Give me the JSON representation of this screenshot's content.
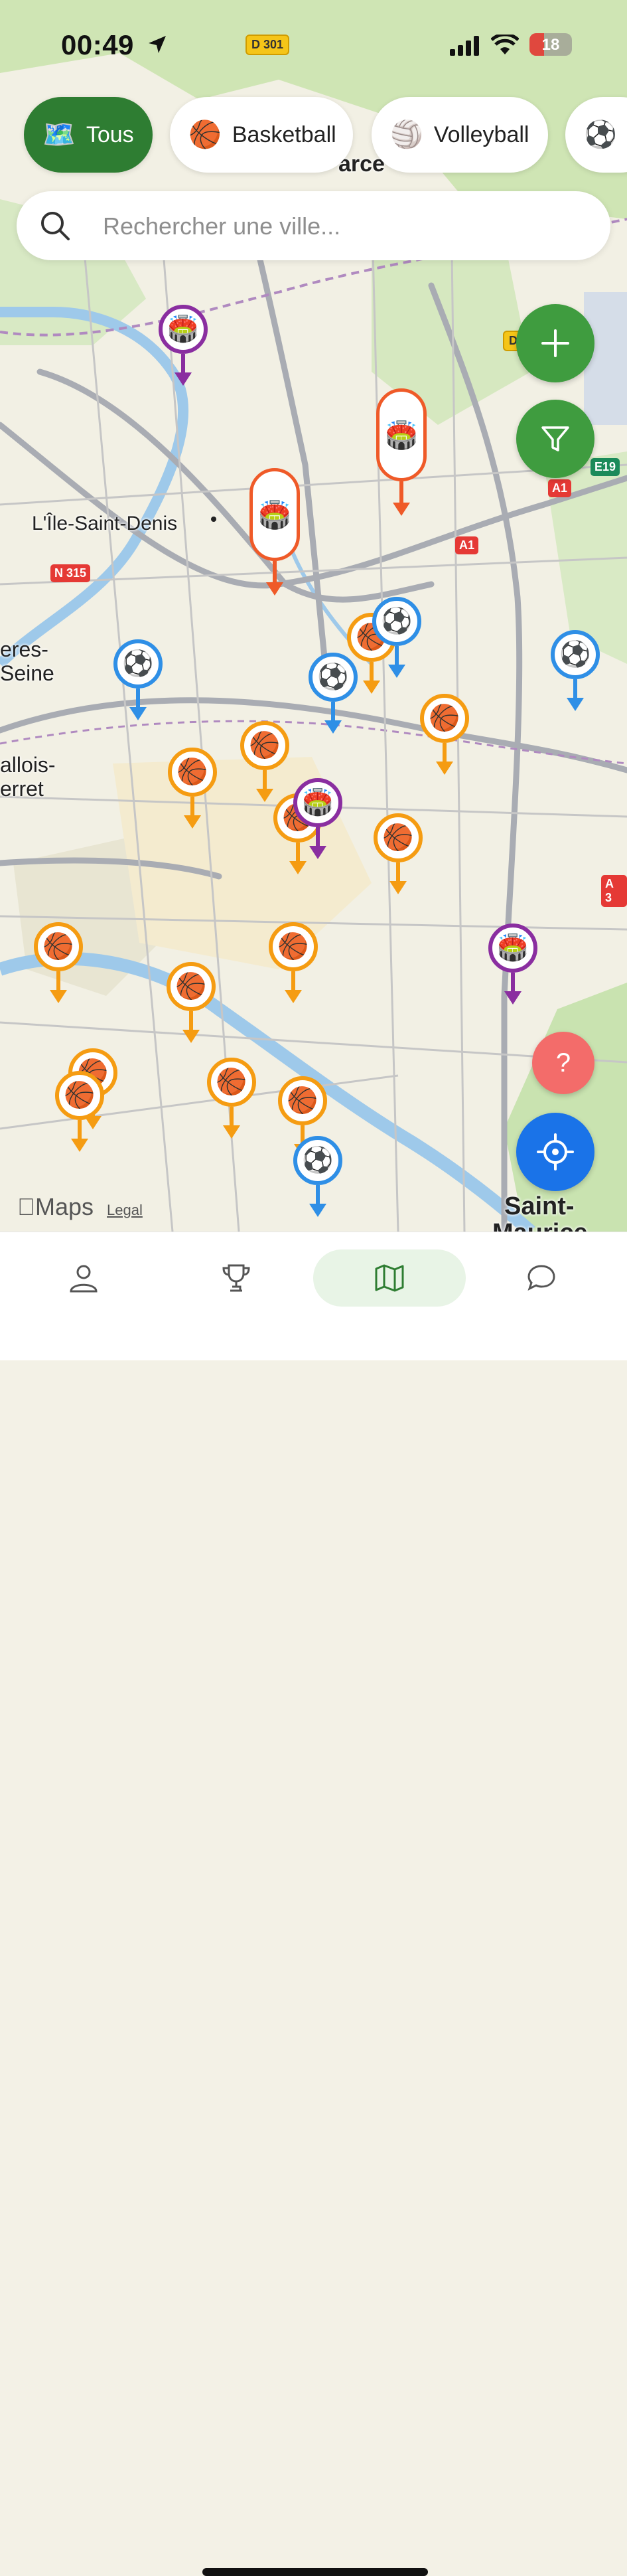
{
  "status_bar": {
    "time": "00:49",
    "battery": "18",
    "road_badge": "D 301"
  },
  "filters": [
    {
      "label": "Tous",
      "icon": "🗺️",
      "active": true
    },
    {
      "label": "Basketball",
      "icon": "🏀",
      "active": false
    },
    {
      "label": "Volleyball",
      "icon": "🏐",
      "active": false
    },
    {
      "label": "",
      "icon": "⚽",
      "active": false
    }
  ],
  "search": {
    "placeholder": "Rechercher une ville..."
  },
  "map": {
    "labels": {
      "ile_saint_denis": "L'Île-Saint-Denis",
      "asnieres_1": "eres-",
      "asnieres_2": "Seine",
      "levallois_1": "allois-",
      "levallois_2": "erret",
      "saint_maurice_1": "Saint-",
      "saint_maurice_2": "Maurice",
      "top_partial": "arce"
    },
    "shields": {
      "n315": "N 315",
      "a1_top": "A1",
      "a1_mid": "A1",
      "e19": "E19",
      "a3": "A 3",
      "d_right": "D"
    },
    "attribution": {
      "maps": "Maps",
      "legal": "Legal"
    },
    "pin_types": {
      "orange": "basketball-pin",
      "blue": "football-pin",
      "purple": "stadium-pin",
      "red_tall": "stadium-event-pin"
    },
    "colors": {
      "basketball": "#f59c12",
      "football": "#2f8fe6",
      "stadium": "#8a2ea0",
      "event": "#ef5a28",
      "primary_green": "#2e7d32",
      "fab_green": "#3f9c3f",
      "help_red": "#f36c6a",
      "locate_blue": "#1a73e8"
    }
  },
  "fabs": {
    "add": "add-icon",
    "filter": "filter-icon",
    "help": "?",
    "locate": "locate-icon"
  },
  "tabbar": {
    "items": [
      "profile-icon",
      "trophy-icon",
      "map-icon",
      "chat-icon"
    ],
    "active": "map-icon"
  }
}
